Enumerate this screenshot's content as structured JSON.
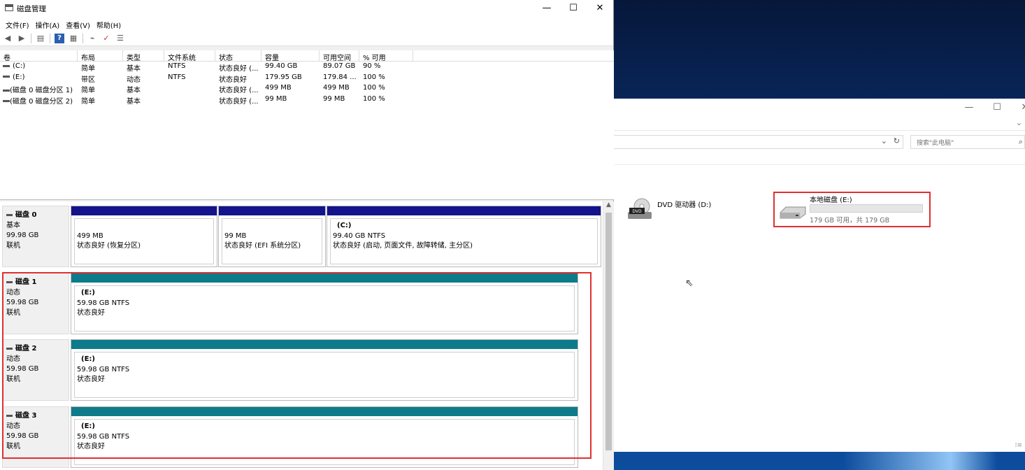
{
  "dm": {
    "title": "磁盘管理",
    "window_controls": {
      "minimize": "—",
      "maximize": "☐",
      "close": "✕"
    },
    "menu": [
      "文件(F)",
      "操作(A)",
      "查看(V)",
      "帮助(H)"
    ],
    "volume_table": {
      "columns": [
        "卷",
        "布局",
        "类型",
        "文件系统",
        "状态",
        "容量",
        "可用空间",
        "% 可用"
      ],
      "rows": [
        [
          "(C:)",
          "简单",
          "基本",
          "NTFS",
          "状态良好 (...",
          "99.40 GB",
          "89.07 GB",
          "90 %"
        ],
        [
          "(E:)",
          "带区",
          "动态",
          "NTFS",
          "状态良好",
          "179.95 GB",
          "179.84 ...",
          "100 %"
        ],
        [
          "(磁盘 0 磁盘分区 1)",
          "简单",
          "基本",
          "",
          "状态良好 (...",
          "499 MB",
          "499 MB",
          "100 %"
        ],
        [
          "(磁盘 0 磁盘分区 2)",
          "简单",
          "基本",
          "",
          "状态良好 (...",
          "99 MB",
          "99 MB",
          "100 %"
        ]
      ]
    },
    "disks": [
      {
        "name": "磁盘 0",
        "type": "基本",
        "size": "99.98 GB",
        "status": "联机",
        "partitions": [
          {
            "volume": "",
            "line1": "499 MB",
            "line2": "状态良好 (恢复分区)"
          },
          {
            "volume": "",
            "line1": "99 MB",
            "line2": "状态良好 (EFI 系统分区)"
          },
          {
            "volume": "(C:)",
            "line1": "99.40 GB NTFS",
            "line2": "状态良好 (启动, 页面文件, 故障转储, 主分区)"
          }
        ]
      },
      {
        "name": "磁盘 1",
        "type": "动态",
        "size": "59.98 GB",
        "status": "联机",
        "partitions": [
          {
            "volume": "(E:)",
            "line1": "59.98 GB NTFS",
            "line2": "状态良好"
          }
        ]
      },
      {
        "name": "磁盘 2",
        "type": "动态",
        "size": "59.98 GB",
        "status": "联机",
        "partitions": [
          {
            "volume": "(E:)",
            "line1": "59.98 GB NTFS",
            "line2": "状态良好"
          }
        ]
      },
      {
        "name": "磁盘 3",
        "type": "动态",
        "size": "59.98 GB",
        "status": "联机",
        "partitions": [
          {
            "volume": "(E:)",
            "line1": "59.98 GB NTFS",
            "line2": "状态良好"
          }
        ]
      }
    ],
    "colors": {
      "primary_band": "#13138c",
      "dynamic_band": "#0e7b8a",
      "highlight": "#e03030"
    },
    "toolbar_icons": [
      "back-arrow-icon",
      "forward-arrow-icon",
      "console-tree-icon",
      "help-icon",
      "properties-icon",
      "connect-icon",
      "check-icon",
      "settings-list-icon"
    ]
  },
  "explorer": {
    "window_controls": {
      "minimize": "—",
      "maximize": "☐",
      "close": "✕"
    },
    "search_placeholder": "搜索\"此电脑\"",
    "dvd": {
      "label": "DVD 驱动器 (D:)",
      "badge": "DVD"
    },
    "drive_e": {
      "name": "本地磁盘 (E:)",
      "free_text": "179 GB 可用，共 179 GB",
      "used_fraction": 0.0
    },
    "corner_icon": "details-view-icon"
  }
}
